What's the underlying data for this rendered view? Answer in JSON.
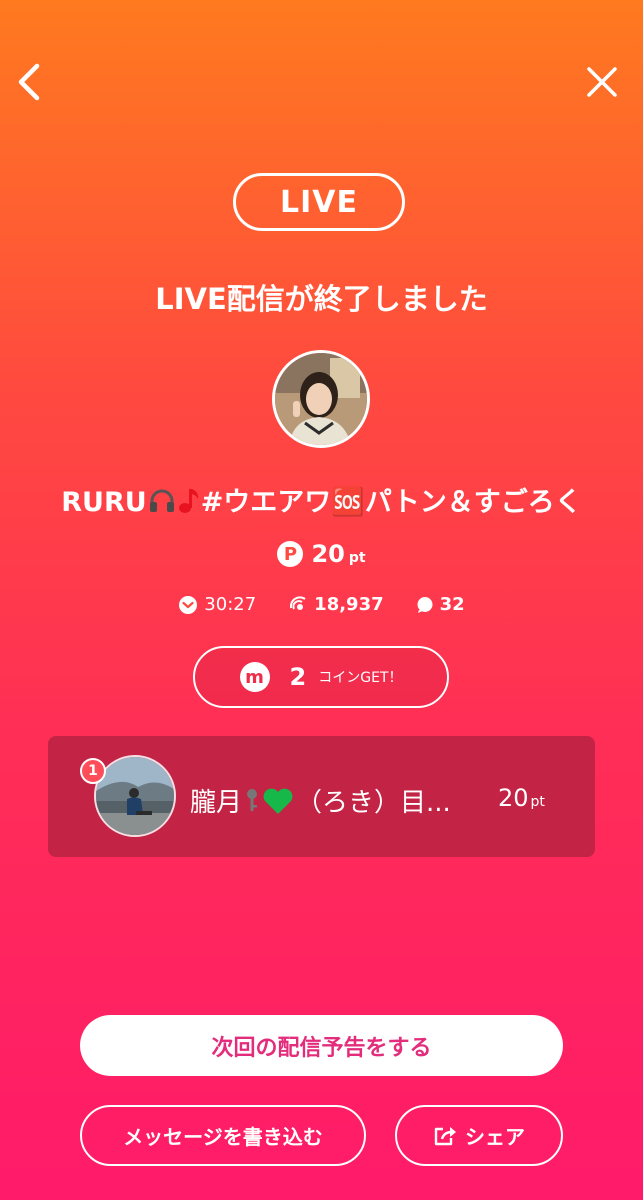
{
  "header": {
    "back_icon": "chevron-left-icon",
    "close_icon": "close-icon"
  },
  "live_badge": "LIVE",
  "ended_title": "LIVE配信が終了しました",
  "streamer": {
    "avatar_icon": "streamer-avatar-photo",
    "title_prefix": "RURU",
    "title_suffix": "#ウエアワ🆘パトン＆すごろく"
  },
  "points": {
    "icon": "P",
    "value": "20",
    "unit": "pt"
  },
  "stats": {
    "duration": "30:27",
    "viewers": "18,937",
    "comments": "32"
  },
  "coin": {
    "icon": "m",
    "count": "2",
    "text": "コインGET！"
  },
  "ranking": {
    "rank": "1",
    "name_start": "朧月",
    "name_end": "（ろき）目...",
    "points_value": "20",
    "points_unit": "pt",
    "heart_color": "#16b84a"
  },
  "buttons": {
    "announce": "次回の配信予告をする",
    "message": "メッセージを書き込む",
    "share": "シェア"
  }
}
